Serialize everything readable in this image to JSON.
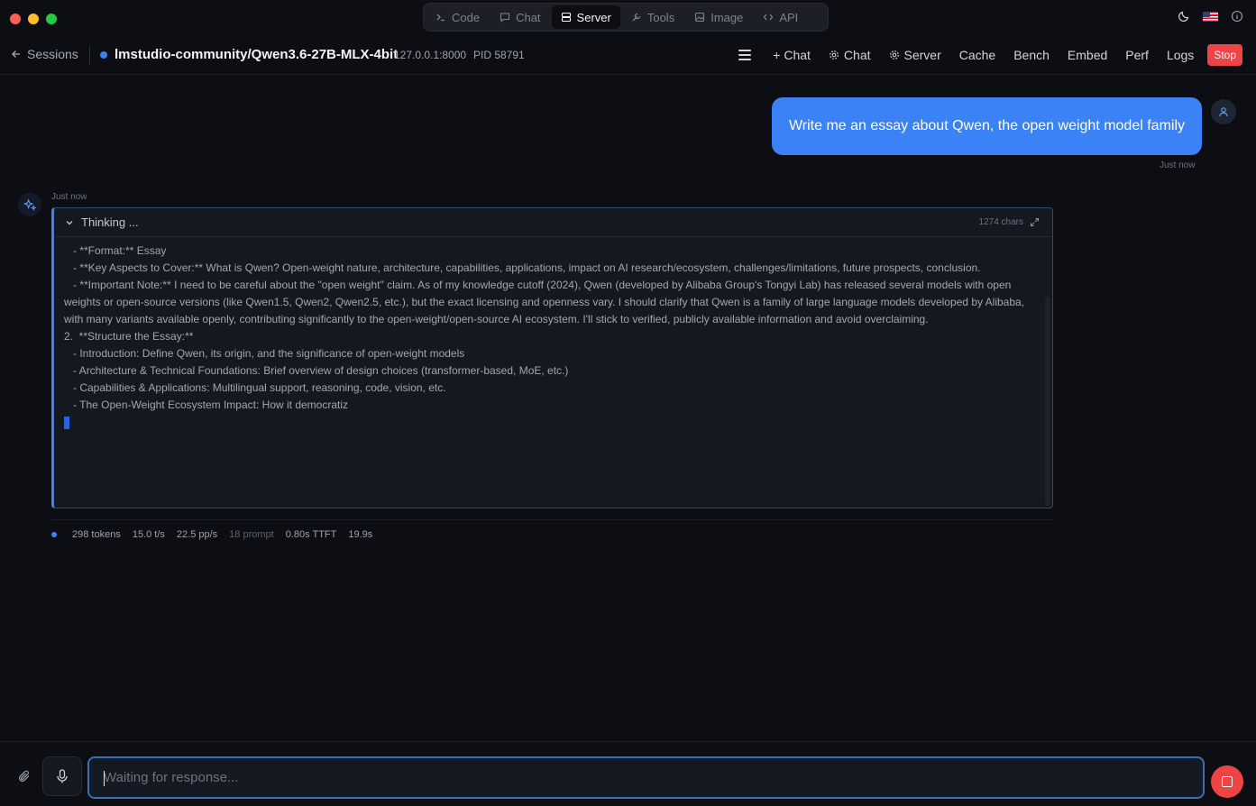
{
  "mode_tabs": [
    {
      "label": "Code",
      "icon": "terminal-icon",
      "active": false
    },
    {
      "label": "Chat",
      "icon": "message-icon",
      "active": false
    },
    {
      "label": "Server",
      "icon": "server-icon",
      "active": true
    },
    {
      "label": "Tools",
      "icon": "wrench-icon",
      "active": false
    },
    {
      "label": "Image",
      "icon": "image-icon",
      "active": false
    },
    {
      "label": "API",
      "icon": "code-icon",
      "active": false
    }
  ],
  "header": {
    "back_label": "Sessions",
    "model_name": "lmstudio-community/Qwen3.6-27B-MLX-4bit",
    "address": "127.0.0.1:8000",
    "pid": "PID 58791",
    "actions": {
      "new_chat": "+ Chat",
      "chat": "Chat",
      "server": "Server",
      "cache": "Cache",
      "bench": "Bench",
      "embed": "Embed",
      "perf": "Perf",
      "logs": "Logs",
      "stop": "Stop"
    }
  },
  "user_message": {
    "text": "Write me an essay about Qwen, the open weight model family",
    "time": "Just now"
  },
  "assistant": {
    "time": "Just now",
    "thinking_title": "Thinking ...",
    "char_count": "1274 chars",
    "lines": [
      "   - **Format:** Essay",
      "   - **Key Aspects to Cover:** What is Qwen? Open-weight nature, architecture, capabilities, applications, impact on AI research/ecosystem, challenges/limitations, future prospects, conclusion.",
      "",
      "   - **Important Note:** I need to be careful about the \"open weight\" claim. As of my knowledge cutoff (2024), Qwen (developed by Alibaba Group's Tongyi Lab) has released several models with open weights or open-source versions (like Qwen1.5, Qwen2, Qwen2.5, etc.), but the exact licensing and openness vary. I should clarify that Qwen is a family of large language models developed by Alibaba, with many variants available openly, contributing significantly to the open-weight/open-source AI ecosystem. I'll stick to verified, publicly available information and avoid overclaiming.",
      "",
      "2.  **Structure the Essay:**",
      "   - Introduction: Define Qwen, its origin, and the significance of open-weight models",
      "   - Architecture & Technical Foundations: Brief overview of design choices (transformer-based, MoE, etc.)",
      "   - Capabilities & Applications: Multilingual support, reasoning, code, vision, etc.",
      "   - The Open-Weight Ecosystem Impact: How it democratiz"
    ]
  },
  "stats": {
    "tokens": "298 tokens",
    "speed": "15.0 t/s",
    "prompt_speed": "22.5 pp/s",
    "prompt_tokens": "18 prompt",
    "ttft": "0.80s TTFT",
    "elapsed": "19.9s"
  },
  "composer": {
    "placeholder": "Waiting for response..."
  },
  "colors": {
    "accent": "#3b82f6",
    "stop": "#ef4444",
    "background": "#0c0e14"
  }
}
